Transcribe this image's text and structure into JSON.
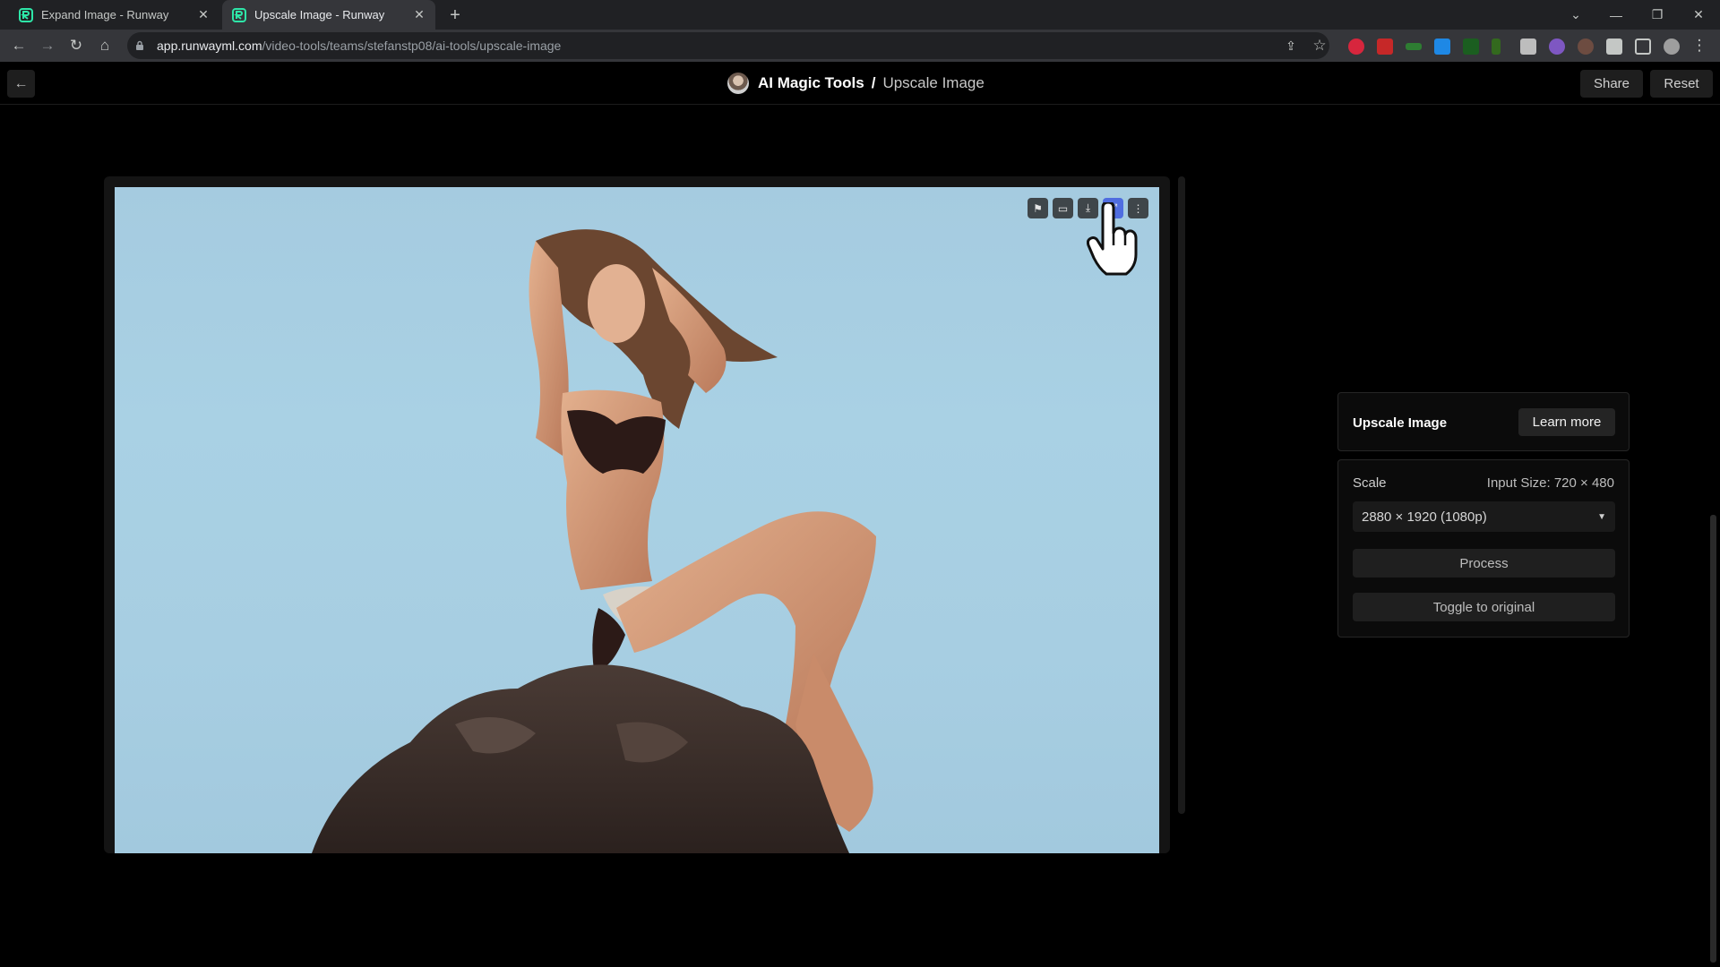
{
  "browser": {
    "tabs": [
      {
        "title": "Expand Image - Runway",
        "active": false
      },
      {
        "title": "Upscale Image - Runway",
        "active": true
      }
    ],
    "new_tab_icon": "plus-icon",
    "address": {
      "host": "app.runwayml.com",
      "path": "/video-tools/teams/stefanstp08/ai-tools/upscale-image"
    }
  },
  "header": {
    "title": "AI Magic Tools",
    "separator": "/",
    "page": "Upscale Image",
    "share_label": "Share",
    "reset_label": "Reset"
  },
  "panel": {
    "title": "Upscale Image",
    "learn_more_label": "Learn more",
    "scale_label": "Scale",
    "input_size": "Input Size: 720 × 480",
    "scale_option_selected": "2880 × 1920 (1080p)",
    "process_label": "Process",
    "toggle_label": "Toggle to original"
  },
  "image_tools": [
    "flag-icon",
    "folder-icon",
    "download-icon",
    "expand-icon",
    "more-vertical-icon"
  ],
  "colors": {
    "accent": "#4f6de0",
    "runway_green": "#2ee6a8",
    "background": "#000000"
  }
}
